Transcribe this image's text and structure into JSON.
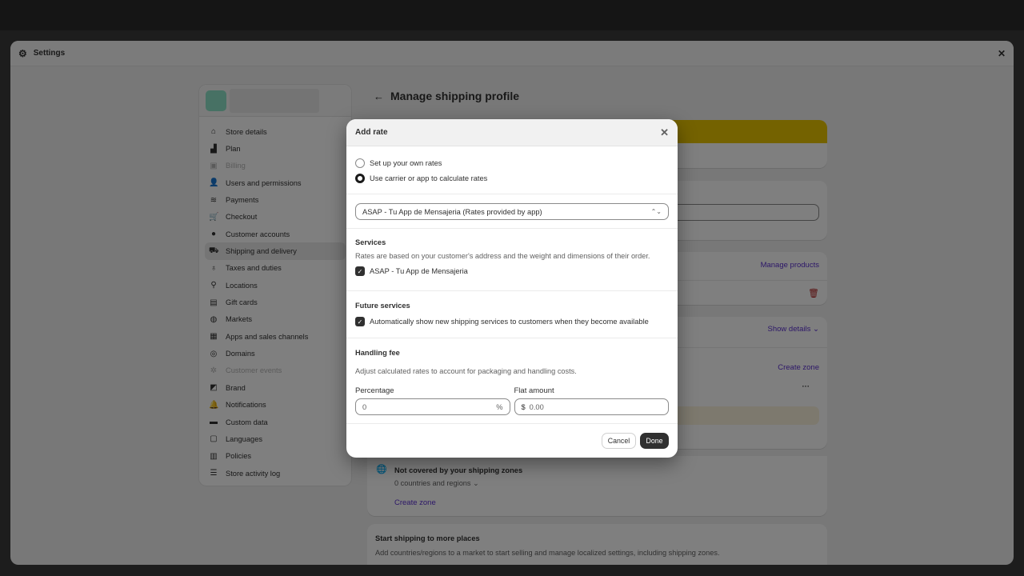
{
  "window": {
    "title": "Settings"
  },
  "sidebar": {
    "items": [
      {
        "label": "Store details",
        "icon": "store-icon",
        "glyph": "⌂"
      },
      {
        "label": "Plan",
        "icon": "plan-icon",
        "glyph": "▟"
      },
      {
        "label": "Billing",
        "icon": "billing-icon",
        "glyph": "▣",
        "disabled": true
      },
      {
        "label": "Users and permissions",
        "icon": "users-icon",
        "glyph": "👤"
      },
      {
        "label": "Payments",
        "icon": "payments-icon",
        "glyph": "≋"
      },
      {
        "label": "Checkout",
        "icon": "cart-icon",
        "glyph": "🛒"
      },
      {
        "label": "Customer accounts",
        "icon": "person-icon",
        "glyph": "●"
      },
      {
        "label": "Shipping and delivery",
        "icon": "truck-icon",
        "glyph": "⛟",
        "active": true
      },
      {
        "label": "Taxes and duties",
        "icon": "tax-icon",
        "glyph": "♁"
      },
      {
        "label": "Locations",
        "icon": "location-icon",
        "glyph": "⚲"
      },
      {
        "label": "Gift cards",
        "icon": "gift-card-icon",
        "glyph": "▤"
      },
      {
        "label": "Markets",
        "icon": "markets-icon",
        "glyph": "◍"
      },
      {
        "label": "Apps and sales channels",
        "icon": "apps-icon",
        "glyph": "▦"
      },
      {
        "label": "Domains",
        "icon": "domains-icon",
        "glyph": "◎"
      },
      {
        "label": "Customer events",
        "icon": "events-icon",
        "glyph": "✲",
        "disabled": true
      },
      {
        "label": "Brand",
        "icon": "brand-icon",
        "glyph": "◩"
      },
      {
        "label": "Notifications",
        "icon": "bell-icon",
        "glyph": "🔔"
      },
      {
        "label": "Custom data",
        "icon": "custom-data-icon",
        "glyph": "▬"
      },
      {
        "label": "Languages",
        "icon": "languages-icon",
        "glyph": "▢"
      },
      {
        "label": "Policies",
        "icon": "policies-icon",
        "glyph": "▥"
      },
      {
        "label": "Store activity log",
        "icon": "list-icon",
        "glyph": "☰"
      }
    ]
  },
  "main": {
    "title": "Manage shipping profile",
    "manage_products": "Manage products",
    "show_details": "Show details",
    "create_zone": "Create zone",
    "not_covered": {
      "title": "Not covered by your shipping zones",
      "count": "0 countries and regions",
      "create_zone": "Create zone"
    },
    "more_places": {
      "title": "Start shipping to more places",
      "desc": "Add countries/regions to a market to start selling and manage localized settings, including shipping zones."
    }
  },
  "modal": {
    "title": "Add rate",
    "options": [
      "Set up your own rates",
      "Use carrier or app to calculate rates"
    ],
    "selected_option": 1,
    "carrier_select": "ASAP - Tu App de Mensajeria (Rates provided by app)",
    "services": {
      "title": "Services",
      "desc": "Rates are based on your customer's address and the weight and dimensions of their order.",
      "item": "ASAP - Tu App de Mensajeria",
      "checked": true
    },
    "future": {
      "title": "Future services",
      "item": "Automatically show new shipping services to customers when they become available",
      "checked": true
    },
    "handling": {
      "title": "Handling fee",
      "desc": "Adjust calculated rates to account for packaging and handling costs.",
      "percentage_label": "Percentage",
      "percentage_value": "0",
      "percentage_suffix": "%",
      "flat_label": "Flat amount",
      "flat_prefix": "$",
      "flat_value": "0.00"
    },
    "cancel": "Cancel",
    "done": "Done"
  },
  "colors": {
    "accent": "#5a2fd0",
    "banner": "#e8c400",
    "primary_button": "#303030"
  }
}
